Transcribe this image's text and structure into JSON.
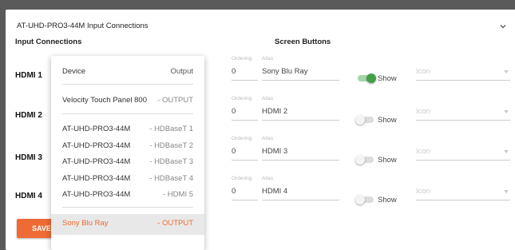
{
  "panel": {
    "title": "AT-UHD-PRO3-44M Input Connections"
  },
  "sections": {
    "input_connections": "Input Connections",
    "screen_buttons": "Screen Buttons"
  },
  "inputs": [
    {
      "label": "HDMI 1",
      "ordering_label": "Ordering",
      "ordering": "0",
      "alias_label": "Alias",
      "alias": "Sony Blu Ray",
      "show_label": "Show",
      "show": true,
      "icon_placeholder": "Icon"
    },
    {
      "label": "HDMI 2",
      "ordering_label": "Ordering",
      "ordering": "0",
      "alias_label": "Alias",
      "alias": "HDMI 2",
      "show_label": "Show",
      "show": false,
      "icon_placeholder": "Icon"
    },
    {
      "label": "HDMI 3",
      "ordering_label": "Ordering",
      "ordering": "0",
      "alias_label": "Alias",
      "alias": "HDMI 3",
      "show_label": "Show",
      "show": false,
      "icon_placeholder": "Icon"
    },
    {
      "label": "HDMI 4",
      "ordering_label": "Ordering",
      "ordering": "0",
      "alias_label": "Alias",
      "alias": "HDMI 4",
      "show_label": "Show",
      "show": false,
      "icon_placeholder": "Icon"
    }
  ],
  "save_button": "SAVE",
  "dropdown": {
    "header": {
      "device": "Device",
      "output": "Output"
    },
    "items": [
      {
        "device": "Velocity Touch Panel 800",
        "output": "- OUTPUT"
      },
      {
        "device": "AT-UHD-PRO3-44M",
        "output": "- HDBaseT 1"
      },
      {
        "device": "AT-UHD-PRO3-44M",
        "output": "- HDBaseT 2"
      },
      {
        "device": "AT-UHD-PRO3-44M",
        "output": "- HDBaseT 3"
      },
      {
        "device": "AT-UHD-PRO3-44M",
        "output": "- HDBaseT 4"
      },
      {
        "device": "AT-UHD-PRO3-44M",
        "output": "- HDMI 5"
      },
      {
        "device": "Sony Blu Ray",
        "output": "- OUTPUT",
        "selected": true
      }
    ]
  },
  "colors": {
    "accent": "#ef6b35",
    "toggle_on": "#43a047"
  }
}
